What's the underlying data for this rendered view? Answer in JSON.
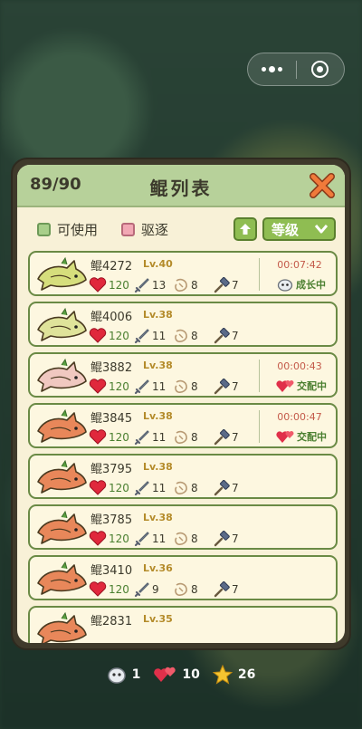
{
  "header": {
    "count": "89/90",
    "title": "鲲列表"
  },
  "filters": [
    {
      "label": "可使用",
      "color": "#a8cf8a"
    },
    {
      "label": "驱逐",
      "color": "#f2a8b4"
    }
  ],
  "sort": {
    "label": "等级"
  },
  "colors": {
    "green_btn": "#8fbd52",
    "panel_cream": "#f8f1d7",
    "header_green": "#b7d19a",
    "row_border": "#6a8a45"
  },
  "rows": [
    {
      "name": "鲲4272",
      "level": "Lv.40",
      "hp": "120",
      "atk": "13",
      "def": "8",
      "hammer": "7",
      "timer": "00:07:42",
      "status": "成长中",
      "status_icon": "egg-icon",
      "fish_color": "#d6de7c"
    },
    {
      "name": "鲲4006",
      "level": "Lv.38",
      "hp": "120",
      "atk": "11",
      "def": "8",
      "hammer": "7",
      "timer": "",
      "status": "",
      "status_icon": "",
      "fish_color": "#dfe39a"
    },
    {
      "name": "鲲3882",
      "level": "Lv.38",
      "hp": "120",
      "atk": "11",
      "def": "8",
      "hammer": "7",
      "timer": "00:00:43",
      "status": "交配中",
      "status_icon": "hearts-icon",
      "fish_color": "#f0c8c0"
    },
    {
      "name": "鲲3845",
      "level": "Lv.38",
      "hp": "120",
      "atk": "11",
      "def": "8",
      "hammer": "7",
      "timer": "00:00:47",
      "status": "交配中",
      "status_icon": "hearts-icon",
      "fish_color": "#e8875a"
    },
    {
      "name": "鲲3795",
      "level": "Lv.38",
      "hp": "120",
      "atk": "11",
      "def": "8",
      "hammer": "7",
      "timer": "",
      "status": "",
      "status_icon": "",
      "fish_color": "#e8875a"
    },
    {
      "name": "鲲3785",
      "level": "Lv.38",
      "hp": "120",
      "atk": "11",
      "def": "8",
      "hammer": "7",
      "timer": "",
      "status": "",
      "status_icon": "",
      "fish_color": "#e8875a"
    },
    {
      "name": "鲲3410",
      "level": "Lv.36",
      "hp": "120",
      "atk": "9",
      "def": "8",
      "hammer": "7",
      "timer": "",
      "status": "",
      "status_icon": "",
      "fish_color": "#e8875a"
    },
    {
      "name": "鲲2831",
      "level": "Lv.35",
      "hp": "",
      "atk": "",
      "def": "",
      "hammer": "",
      "timer": "",
      "status": "",
      "status_icon": "",
      "fish_color": "#e8875a"
    }
  ],
  "resources": [
    {
      "icon": "egg-icon",
      "value": "1"
    },
    {
      "icon": "hearts-icon",
      "value": "10"
    },
    {
      "icon": "star-icon",
      "value": "26"
    }
  ]
}
